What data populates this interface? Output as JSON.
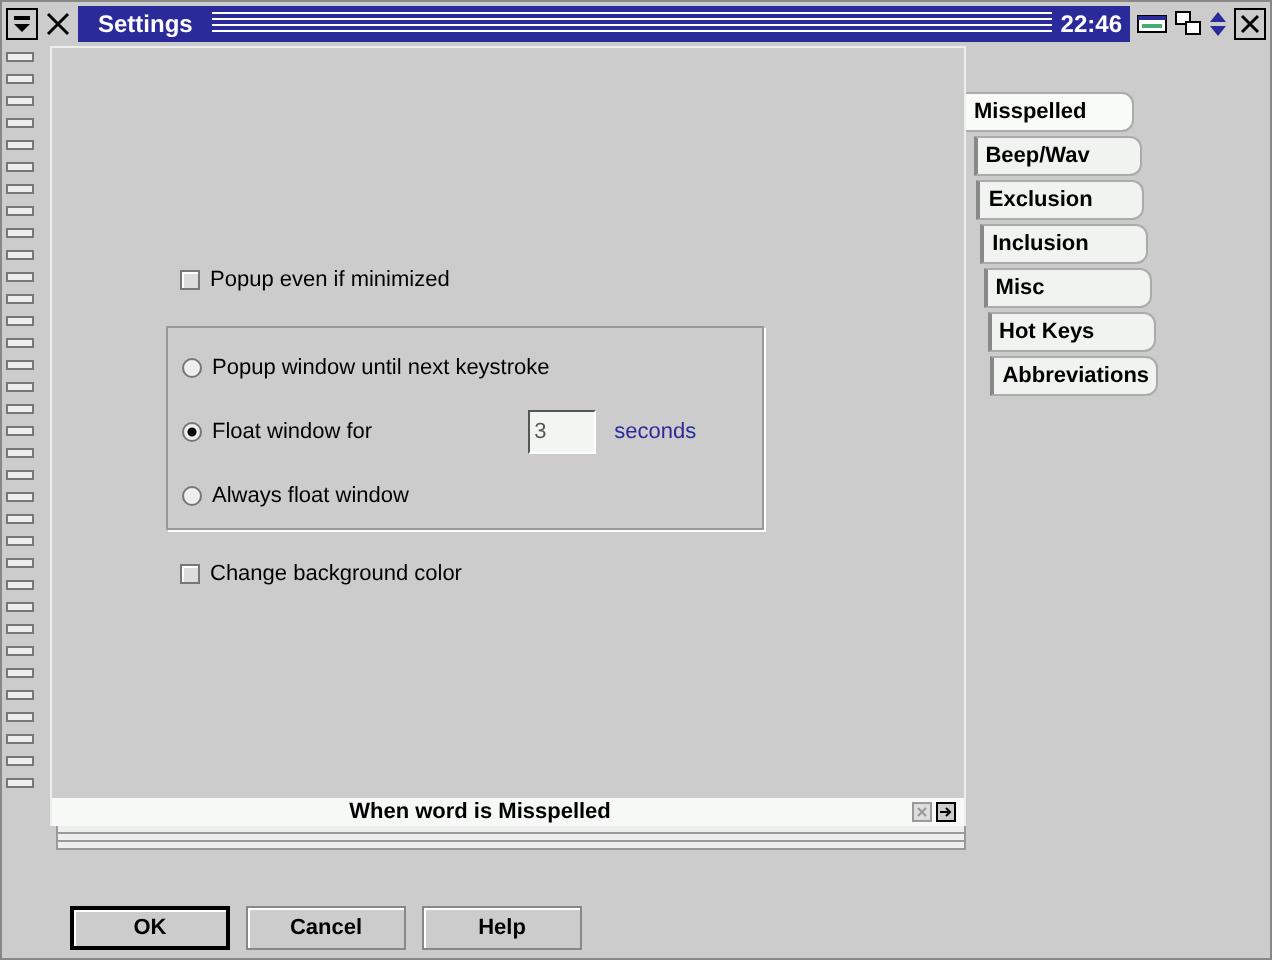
{
  "window": {
    "title": "Settings",
    "clock": "22:46"
  },
  "popup_minimized": {
    "label": "Popup even if minimized",
    "checked": false
  },
  "display_modes": [
    {
      "label": "Popup window until next keystroke",
      "selected": false,
      "kind": "plain"
    },
    {
      "label": "Float window for",
      "selected": true,
      "kind": "timed"
    },
    {
      "label": "Always float window",
      "selected": false,
      "kind": "plain"
    }
  ],
  "float_time": {
    "value": "3",
    "unit": "seconds"
  },
  "change_background": {
    "label": "Change background color",
    "checked": false
  },
  "status": "When word is Misspelled",
  "tabs": [
    {
      "label": "Misspelled",
      "selected": true
    },
    {
      "label": "Beep/Wav",
      "selected": false
    },
    {
      "label": "Exclusion",
      "selected": false
    },
    {
      "label": "Inclusion",
      "selected": false
    },
    {
      "label": "Misc",
      "selected": false
    },
    {
      "label": "Hot Keys",
      "selected": false
    },
    {
      "label": "Abbreviations",
      "selected": false
    }
  ],
  "buttons": [
    {
      "label": "OK",
      "default": true
    },
    {
      "label": "Cancel",
      "default": false
    },
    {
      "label": "Help",
      "default": false
    }
  ]
}
